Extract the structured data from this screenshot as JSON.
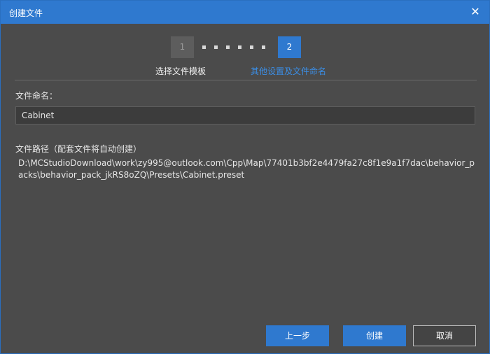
{
  "window": {
    "title": "创建文件"
  },
  "steps": {
    "step1_number": "1",
    "step2_number": "2",
    "step1_label": "选择文件模板",
    "step2_label": "其他设置及文件命名"
  },
  "form": {
    "name_label": "文件命名：",
    "name_value": "Cabinet",
    "path_label": "文件路径（配套文件将自动创建）",
    "path_value": "D:\\MCStudioDownload\\work\\zy995@outlook.com\\Cpp\\Map\\77401b3bf2e4479fa27c8f1e9a1f7dac\\behavior_packs\\behavior_pack_jkRS8oZQ\\Presets\\Cabinet.preset"
  },
  "buttons": {
    "prev": "上一步",
    "create": "创建",
    "cancel": "取消"
  },
  "colors": {
    "accent": "#2f79cf",
    "background": "#4b4b4b",
    "active_step_label": "#3b8ee6"
  }
}
